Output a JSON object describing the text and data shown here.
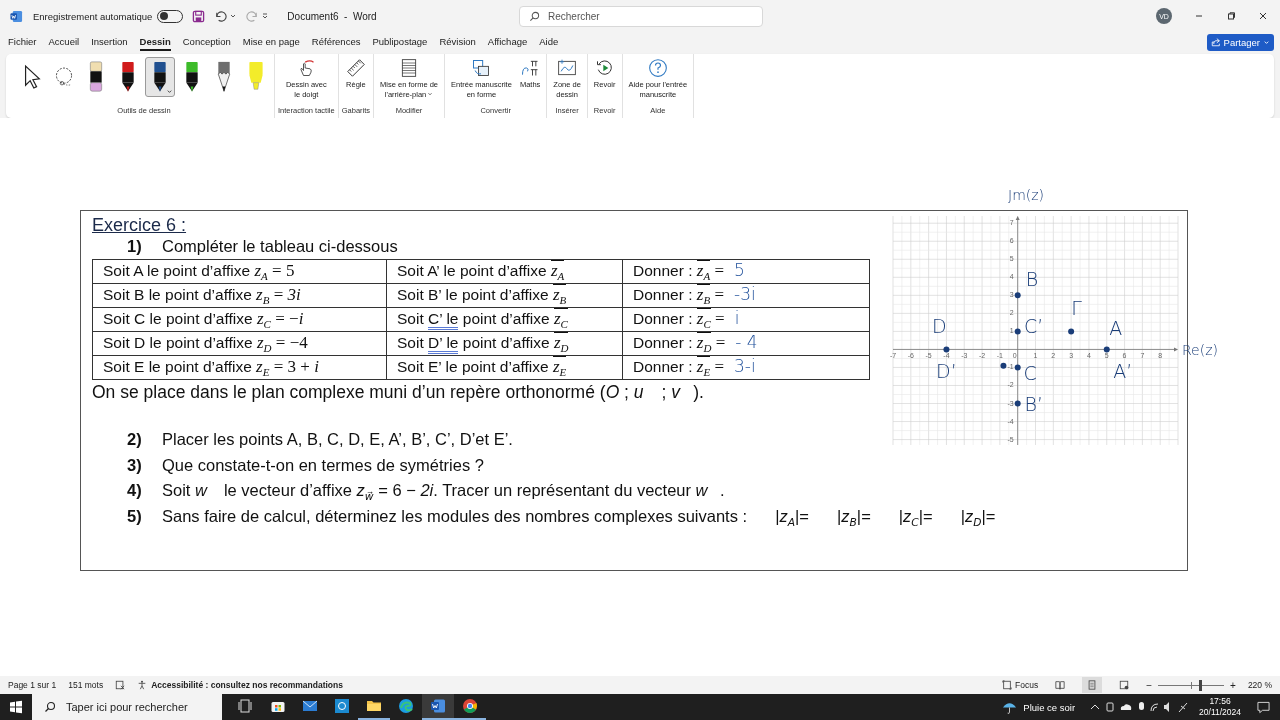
{
  "titlebar": {
    "autosave_label": "Enregistrement automatique",
    "autosave_on": false,
    "document_title": "Document6  -  Word",
    "search_placeholder": "Rechercher",
    "avatar": "VD"
  },
  "menu_tabs": [
    {
      "label": "Fichier",
      "selected": false
    },
    {
      "label": "Accueil",
      "selected": false
    },
    {
      "label": "Insertion",
      "selected": false
    },
    {
      "label": "Dessin",
      "selected": true
    },
    {
      "label": "Conception",
      "selected": false
    },
    {
      "label": "Mise en page",
      "selected": false
    },
    {
      "label": "Références",
      "selected": false
    },
    {
      "label": "Publipostage",
      "selected": false
    },
    {
      "label": "Révision",
      "selected": false
    },
    {
      "label": "Affichage",
      "selected": false
    },
    {
      "label": "Aide",
      "selected": false
    }
  ],
  "share_button": "Partager",
  "ribbon_groups": [
    {
      "label": "Outils de dessin",
      "tools": [
        {
          "kind": "select",
          "selected": false
        },
        {
          "kind": "lasso",
          "selected": false
        },
        {
          "kind": "eraser",
          "selected": false
        },
        {
          "kind": "pen",
          "color": "#d01c1c",
          "selected": false
        },
        {
          "kind": "pen",
          "color": "#1f4f8f",
          "selected": true
        },
        {
          "kind": "pen",
          "color": "#3dbb2a",
          "selected": false
        },
        {
          "kind": "pencil",
          "color": "#6e6e6e",
          "selected": false
        },
        {
          "kind": "highlighter",
          "color": "#f3ec2a",
          "selected": false
        }
      ]
    },
    {
      "label": "Interaction tactile",
      "buttons": [
        {
          "kind": "finger",
          "label": "Dessin avec\nle doigt",
          "dropdown": false
        }
      ]
    },
    {
      "label": "Gabarits",
      "buttons": [
        {
          "kind": "ruler",
          "label": "Règle",
          "dropdown": false
        }
      ]
    },
    {
      "label": "Modifier",
      "buttons": [
        {
          "kind": "lines",
          "label": "Mise en forme de\nl'arrière-plan",
          "dropdown": true
        }
      ]
    },
    {
      "label": "Convertir",
      "buttons": [
        {
          "kind": "shapes",
          "label": "Entrée manuscrite\nen forme",
          "dropdown": false
        },
        {
          "kind": "pi",
          "label": "Maths",
          "dropdown": false
        }
      ]
    },
    {
      "label": "Insérer",
      "buttons": [
        {
          "kind": "canvas",
          "label": "Zone de\ndessin",
          "dropdown": false
        }
      ]
    },
    {
      "label": "Revoir",
      "buttons": [
        {
          "kind": "replay",
          "label": "Revoir",
          "dropdown": false
        }
      ]
    },
    {
      "label": "Aide",
      "buttons": [
        {
          "kind": "help",
          "label": "Aide pour l'entrée\nmanuscrite",
          "dropdown": false
        }
      ]
    }
  ],
  "exercise": {
    "title": "Exercice 6 :",
    "q1": {
      "number": "1)",
      "text": "Compléter le tableau ci-dessous"
    },
    "table_rows": [
      {
        "point": {
          "text": "Soit A le point d’affixe",
          "var": "z",
          "sub": "A",
          "rhs": "= 5"
        },
        "image": {
          "parts": [
            {
              "text": "Soit A’ le point d’affixe",
              "flagged": false
            }
          ],
          "var": "z",
          "sub": "A"
        },
        "answer": {
          "text": "Donner :",
          "var": "z",
          "sub": "A",
          "rhs": "=",
          "handwritten": "5"
        }
      },
      {
        "point": {
          "text": "Soit B le point d’affixe",
          "var": "z",
          "sub": "B",
          "rhs": "= *3i*"
        },
        "image": {
          "parts": [
            {
              "text": "Soit B’ le point d’affixe",
              "flagged": false
            }
          ],
          "var": "z",
          "sub": "B"
        },
        "answer": {
          "text": "Donner :",
          "var": "z",
          "sub": "B",
          "rhs": "=",
          "handwritten": "-3i"
        }
      },
      {
        "point": {
          "text": "Soit C le point d’affixe",
          "var": "z",
          "sub": "C",
          "rhs": "= −*i*"
        },
        "image": {
          "parts": [
            {
              "text": "Soit",
              "flagged": false
            },
            {
              "text": "C’ le",
              "flagged": true
            },
            {
              "text": "point d’affixe",
              "flagged": false
            }
          ],
          "var": "z",
          "sub": "C"
        },
        "answer": {
          "text": "Donner :",
          "var": "z",
          "sub": "C",
          "rhs": "=",
          "handwritten": "i"
        }
      },
      {
        "point": {
          "text": "Soit D le point d’affixe",
          "var": "z",
          "sub": "D",
          "rhs": "= −4"
        },
        "image": {
          "parts": [
            {
              "text": "Soit",
              "flagged": false
            },
            {
              "text": "D’ le",
              "flagged": true
            },
            {
              "text": "point d’affixe",
              "flagged": false
            }
          ],
          "var": "z",
          "sub": "D"
        },
        "answer": {
          "text": "Donner :",
          "var": "z",
          "sub": "D",
          "rhs": "=",
          "handwritten": "- 4"
        }
      },
      {
        "point": {
          "text": "Soit E le point d’affixe",
          "var": "z",
          "sub": "E",
          "rhs": "=  3 + *i*"
        },
        "image": {
          "parts": [
            {
              "text": "Soit E’ le point d’affixe",
              "flagged": false
            }
          ],
          "var": "z",
          "sub": "E"
        },
        "answer": {
          "text": "Donner :",
          "var": "z",
          "sub": "E",
          "rhs": "=",
          "handwritten": "3-i"
        }
      }
    ],
    "intro": "On se place dans le plan complexe muni d’un repère orthonormé (*O* ; *u⃗* ; *v⃗*).",
    "questions": [
      {
        "number": "2)",
        "text": "Placer les points A, B, C, D, E, A’, B’, C’, D’et E’."
      },
      {
        "number": "3)",
        "text": "Que constate-t-on en termes de symétries ?"
      },
      {
        "number": "4)",
        "text": "Soit *w⃗* le vecteur d’affixe *z*$_{w⃗}$ = 6 − *2i*. Tracer un représentant du vecteur *w⃗*."
      },
      {
        "number": "5)",
        "text": "Sans faire de calcul, déterminez les modules des nombres complexes suivants :",
        "blanks": [
          "|*z*$_{A}$|=",
          "|*z*$_{B}$|=",
          "|*z*$_{C}$|=",
          "|*z*$_{D}$|="
        ]
      }
    ]
  },
  "graph": {
    "chart_data": {
      "type": "scatter",
      "xlabel": "Re(z)",
      "ylabel": "Jm(z)",
      "grid": true,
      "xlim": [
        -7,
        9
      ],
      "ylim": [
        -5.3,
        7.4
      ],
      "xticks": [
        -7,
        -6,
        -5,
        -4,
        -3,
        -2,
        -1,
        0,
        1,
        2,
        3,
        4,
        5,
        6,
        7,
        8
      ],
      "yticks": [
        -5,
        -4,
        -3,
        -2,
        -1,
        1,
        2,
        3,
        4,
        5,
        6,
        7
      ],
      "x": [
        -4,
        0,
        0,
        3,
        5,
        0,
        0,
        -0.8
      ],
      "series": [
        {
          "color": "#1a3d78",
          "values": [
            0,
            3,
            1,
            1,
            0,
            -1,
            -3,
            -0.9
          ]
        }
      ],
      "annotations": [
        "D",
        "B",
        "C’",
        "Γ",
        "A",
        "D’",
        "A’",
        "C",
        "B’"
      ]
    }
  },
  "status_bar": {
    "page": "Page 1 sur 1",
    "words": "151 mots",
    "accessibility": "Accessibilité : consultez nos recommandations",
    "focus": "Focus",
    "views": [
      {
        "kind": "read",
        "selected": false
      },
      {
        "kind": "print",
        "selected": true
      },
      {
        "kind": "web",
        "selected": false
      }
    ],
    "zoom_out": "−",
    "zoom_slider": {
      "level": 0.64
    },
    "zoom_in": "+",
    "zoom": "220 %"
  },
  "taskbar": {
    "search_placeholder": "Taper ici pour rechercher",
    "apps": [
      {
        "kind": "taskview",
        "open": false,
        "active": false
      },
      {
        "kind": "store",
        "open": false,
        "active": false
      },
      {
        "kind": "mail",
        "open": false,
        "active": false
      },
      {
        "kind": "portal",
        "open": false,
        "active": false
      },
      {
        "kind": "folder",
        "open": true,
        "active": false
      },
      {
        "kind": "edge",
        "open": false,
        "active": false
      },
      {
        "kind": "word",
        "open": true,
        "active": true
      },
      {
        "kind": "chrome",
        "open": true,
        "active": false
      }
    ],
    "weather": "Pluie ce soir",
    "time": "17:56",
    "date": "20/11/2024"
  }
}
